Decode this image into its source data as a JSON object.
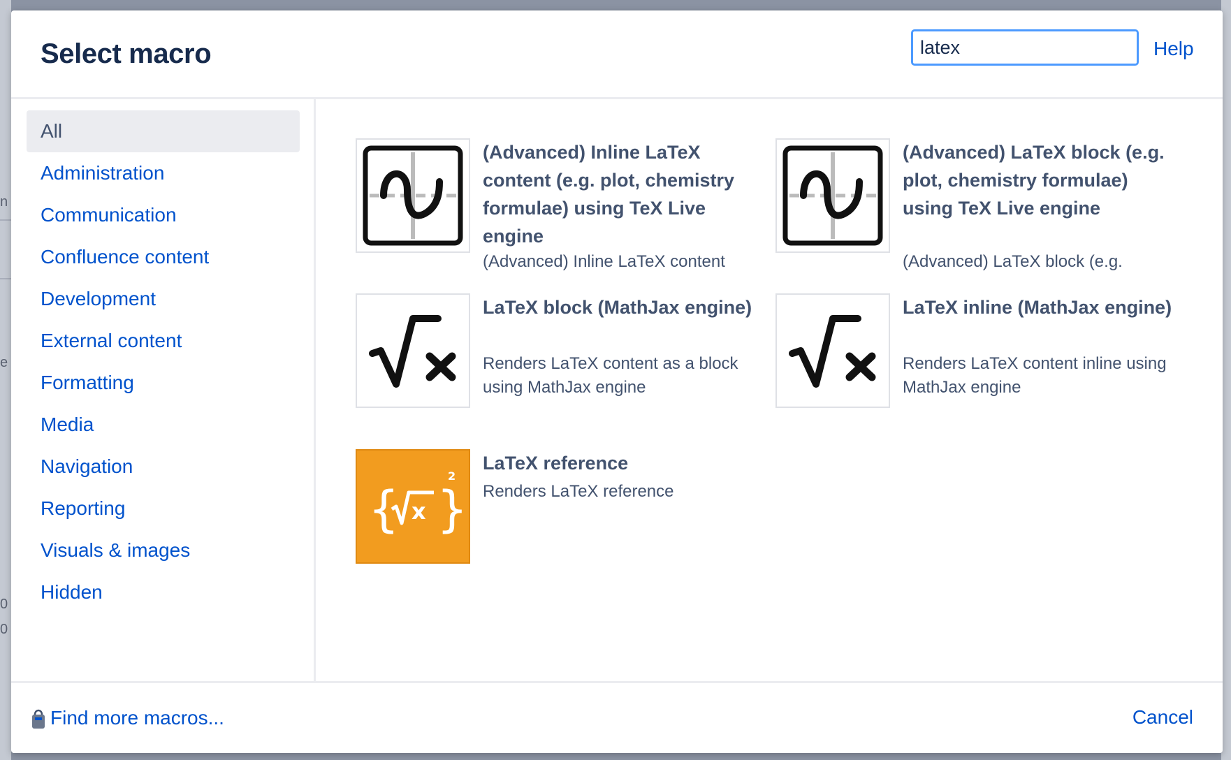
{
  "dialog": {
    "title": "Select macro",
    "search": {
      "value": "latex",
      "placeholder": ""
    },
    "help_label": "Help"
  },
  "sidebar": {
    "items": [
      {
        "label": "All",
        "active": true
      },
      {
        "label": "Administration"
      },
      {
        "label": "Communication"
      },
      {
        "label": "Confluence content"
      },
      {
        "label": "Development"
      },
      {
        "label": "External content"
      },
      {
        "label": "Formatting"
      },
      {
        "label": "Media"
      },
      {
        "label": "Navigation"
      },
      {
        "label": "Reporting"
      },
      {
        "label": "Visuals & images"
      },
      {
        "label": "Hidden"
      }
    ]
  },
  "macros": [
    {
      "name": "(Advanced) Inline LaTeX content (e.g. plot, chemistry formulae) using TeX Live engine",
      "description": "(Advanced) Inline LaTeX content",
      "icon": "sine-graph-icon"
    },
    {
      "name": "(Advanced) LaTeX block (e.g. plot, chemistry formulae) using TeX Live engine",
      "description": "(Advanced) LaTeX block (e.g.",
      "icon": "sine-graph-icon"
    },
    {
      "name": "LaTeX block (MathJax engine)",
      "description": "Renders LaTeX content as a block using MathJax engine",
      "icon": "square-root-x-icon"
    },
    {
      "name": "LaTeX inline (MathJax engine)",
      "description": "Renders LaTeX content inline using MathJax engine",
      "icon": "square-root-x-icon"
    },
    {
      "name": "LaTeX reference",
      "description": "Renders LaTeX reference",
      "icon": "latex-reference-icon"
    }
  ],
  "footer": {
    "find_more_label": "Find more macros...",
    "cancel_label": "Cancel"
  },
  "background_fragments": [
    "n",
    "e",
    "0",
    "0"
  ],
  "colors": {
    "link": "#0052cc",
    "focus_border": "#4c9aff",
    "orange_icon": "#f29c1f"
  }
}
